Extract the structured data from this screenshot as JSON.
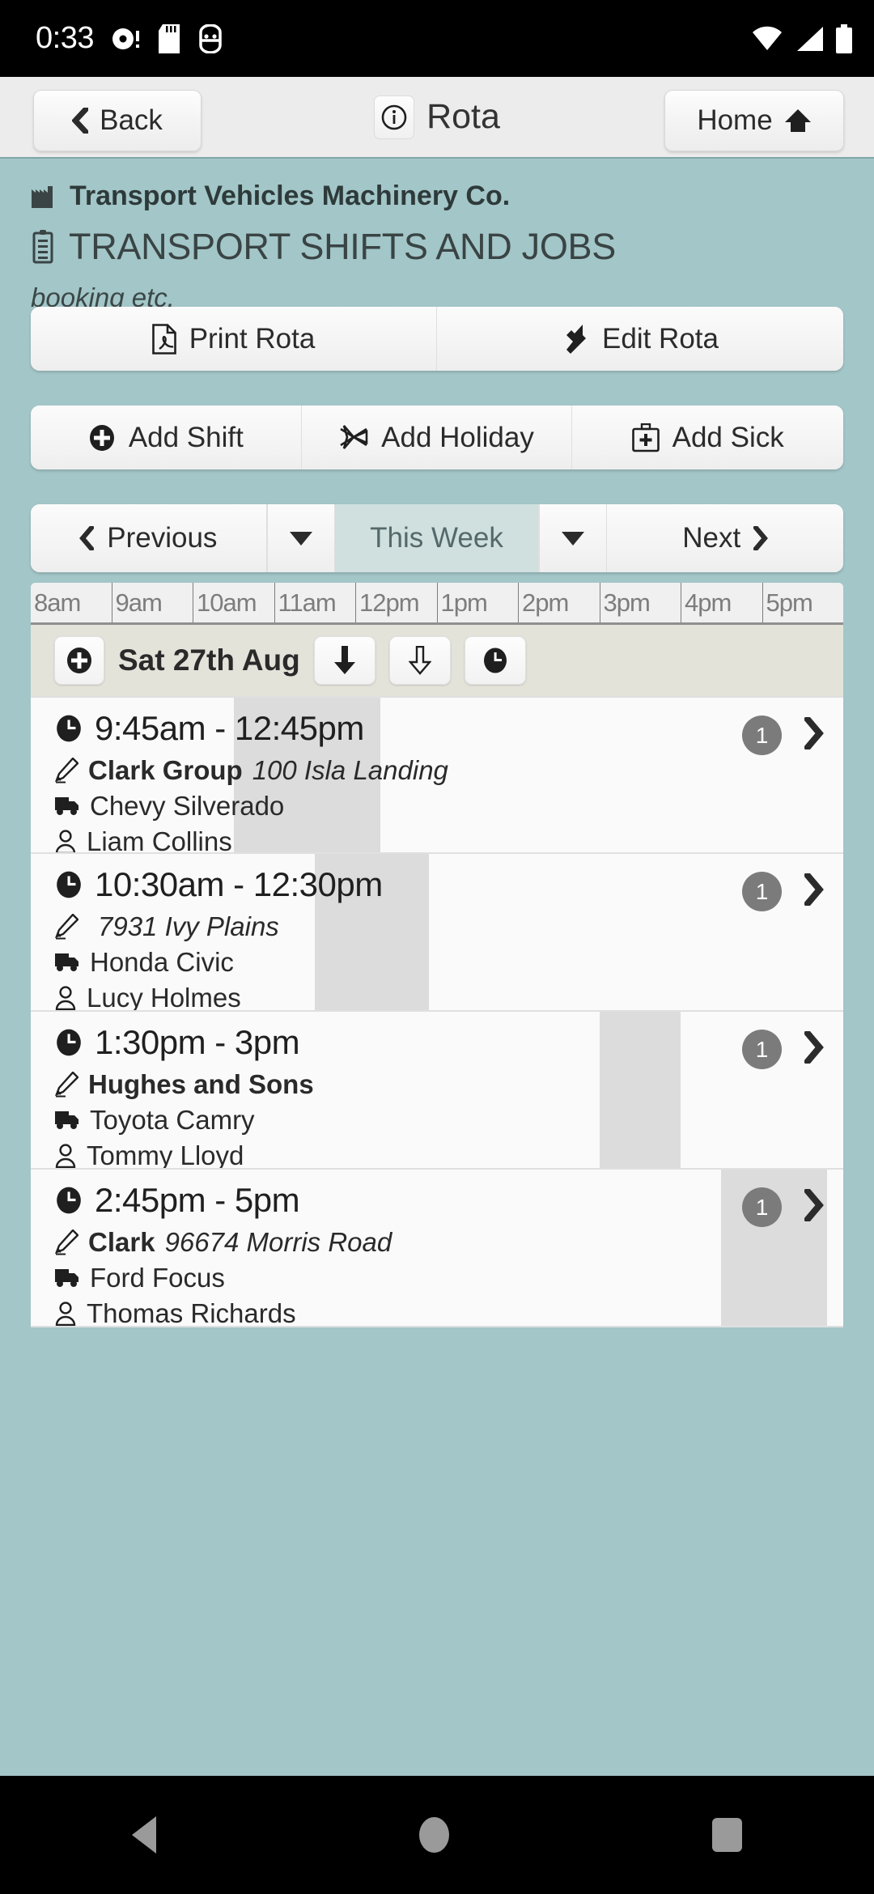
{
  "status_bar": {
    "clock": "0:33",
    "icons": [
      "record-dot-icon",
      "sd-card-icon",
      "usb-debug-icon",
      "wifi-icon",
      "cellular-signal-icon",
      "battery-icon"
    ]
  },
  "app_bar": {
    "back_label": "Back",
    "title": "Rota",
    "info_icon": "info-circle-icon",
    "home_label": "Home",
    "home_icon": "home-icon"
  },
  "header": {
    "company_icon": "factory-icon",
    "company": "Transport Vehicles Machinery Co.",
    "title_icon": "clipboard-icon",
    "title": "TRANSPORT SHIFTS AND JOBS",
    "subtitle": "booking etc."
  },
  "actions": {
    "row1": [
      {
        "label": "Print Rota",
        "icon": "pdf-file-icon"
      },
      {
        "label": "Edit Rota",
        "icon": "wrench-icon"
      }
    ],
    "row2": [
      {
        "label": "Add Shift",
        "icon": "plus-circle-icon"
      },
      {
        "label": "Add Holiday",
        "icon": "airplane-icon"
      },
      {
        "label": "Add Sick",
        "icon": "first-aid-kit-icon"
      }
    ]
  },
  "week_nav": {
    "previous_label": "Previous",
    "previous_icon": "chevron-left-icon",
    "this_week_label": "This Week",
    "next_label": "Next",
    "next_icon": "chevron-right-icon",
    "caret_icon": "caret-down-icon"
  },
  "timeline": {
    "hours": [
      "8am",
      "9am",
      "10am",
      "11am",
      "12pm",
      "1pm",
      "2pm",
      "3pm",
      "4pm",
      "5pm"
    ],
    "day": {
      "label": "Sat 27th Aug",
      "add_icon": "plus-circle-icon",
      "buttons": [
        "arrow-down-solid-icon",
        "arrow-down-outline-icon",
        "clock-icon"
      ]
    },
    "shifts": [
      {
        "time": "9:45am - 12:45pm",
        "customer": "Clark Group",
        "address": "100 Isla Landing",
        "vehicle": "Chevy Silverado",
        "driver": "Liam Collins",
        "count": "1",
        "band_start_pct": 25.0,
        "band_width_pct": 18.0
      },
      {
        "time": "10:30am - 12:30pm",
        "customer": "",
        "address": "7931 Ivy Plains",
        "vehicle": "Honda Civic",
        "driver": "Lucy Holmes",
        "count": "1",
        "band_start_pct": 35.0,
        "band_width_pct": 14.0
      },
      {
        "time": "1:30pm - 3pm",
        "customer": "Hughes and Sons",
        "address": "",
        "vehicle": "Toyota Camry",
        "driver": "Tommy Lloyd",
        "count": "1",
        "band_start_pct": 70.0,
        "band_width_pct": 10.0
      },
      {
        "time": "2:45pm - 5pm",
        "customer": "Clark",
        "address": "96674 Morris Road",
        "vehicle": "Ford Focus",
        "driver": "Thomas Richards",
        "count": "1",
        "band_start_pct": 85.0,
        "band_width_pct": 13.0
      }
    ],
    "icons": {
      "time": "clock-icon",
      "customer": "pencil-icon",
      "vehicle": "truck-icon",
      "driver": "person-icon",
      "chevron": "chevron-right-icon"
    }
  },
  "nav_bar": {
    "back": "nav-back-icon",
    "home": "nav-home-icon",
    "recents": "nav-recents-icon"
  },
  "colors": {
    "teal_background": "#a3c6c8",
    "active_segment": "#cfe0df",
    "day_header": "#e3e3da",
    "band": "#dcdcdc",
    "badge": "#7b7b7b"
  }
}
